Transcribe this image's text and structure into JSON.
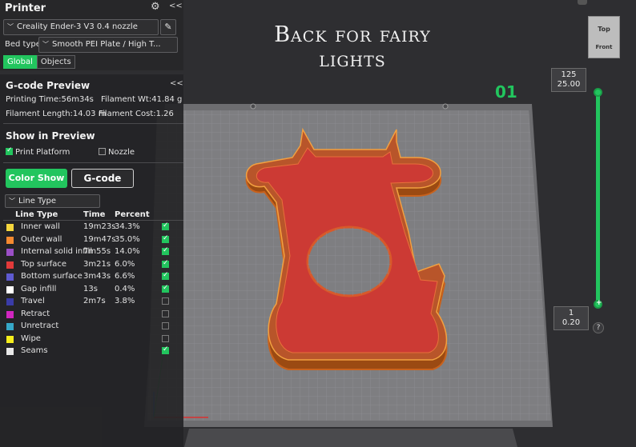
{
  "overlay": {
    "caption": "Back for fairy lights",
    "plate_label": "01"
  },
  "view_cube": {
    "top": "Top",
    "front": "Front"
  },
  "layer_slider": {
    "top_layer": "125",
    "top_height": "25.00",
    "bottom_layer": "1",
    "bottom_height": "0.20",
    "help": "?"
  },
  "printer": {
    "title": "Printer",
    "settings_icon": "gear-icon",
    "collapse": "<<",
    "preset": "Creality Ender-3 V3 0.4 nozzle",
    "bed_type_label": "Bed type",
    "bed_type": "Smooth PEI Plate / High T...",
    "tabs": [
      "Global",
      "Objects"
    ]
  },
  "preview": {
    "title": "G-code Preview",
    "collapse": "<<",
    "printing_time": "Printing Time:56m34s",
    "filament_wt": "Filament Wt:41.84 g",
    "filament_length": "Filament Length:14.03 m",
    "filament_cost": "Filament Cost:1.26",
    "show_title": "Show in Preview",
    "print_platform": "Print Platform",
    "print_platform_checked": true,
    "nozzle": "Nozzle",
    "nozzle_checked": false,
    "color_show": "Color Show",
    "gcode": "G-code",
    "view_type": "Line Type",
    "headers": {
      "type": "Line Type",
      "time": "Time",
      "percent": "Percent"
    },
    "rows": [
      {
        "name": "Inner wall",
        "time": "19m23s",
        "percent": "34.3%",
        "color": "#f5d63d",
        "visible": true
      },
      {
        "name": "Outer wall",
        "time": "19m47s",
        "percent": "35.0%",
        "color": "#f58a30",
        "visible": true
      },
      {
        "name": "Internal solid infill",
        "time": "7m55s",
        "percent": "14.0%",
        "color": "#9b4fc7",
        "visible": true
      },
      {
        "name": "Top surface",
        "time": "3m21s",
        "percent": "6.0%",
        "color": "#e23a3a",
        "visible": true
      },
      {
        "name": "Bottom surface",
        "time": "3m43s",
        "percent": "6.6%",
        "color": "#5e5ad0",
        "visible": true
      },
      {
        "name": "Gap infill",
        "time": "13s",
        "percent": "0.4%",
        "color": "#ffffff",
        "visible": true
      },
      {
        "name": "Travel",
        "time": "2m7s",
        "percent": "3.8%",
        "color": "#3a3ca8",
        "visible": false
      },
      {
        "name": "Retract",
        "time": "",
        "percent": "",
        "color": "#d126c0",
        "visible": false
      },
      {
        "name": "Unretract",
        "time": "",
        "percent": "",
        "color": "#36a8c8",
        "visible": false
      },
      {
        "name": "Wipe",
        "time": "",
        "percent": "",
        "color": "#f5ee1c",
        "visible": false
      },
      {
        "name": "Seams",
        "time": "",
        "percent": "",
        "color": "#e8e8e8",
        "visible": true
      }
    ]
  }
}
